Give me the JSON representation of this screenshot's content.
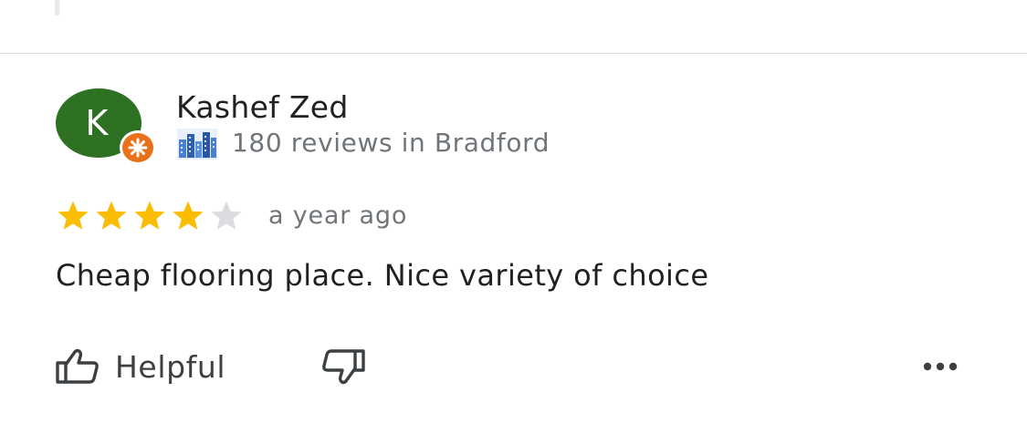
{
  "review": {
    "avatar_initial": "K",
    "avatar_color": "#2e7123",
    "badge_color": "#e8711a",
    "reviewer_name": "Kashef Zed",
    "reviewer_meta": "180 reviews in Bradford",
    "rating": 4,
    "rating_max": 5,
    "star_color_filled": "#fbbc04",
    "star_color_empty": "#dadce0",
    "age": "a year ago",
    "text": "Cheap flooring place. Nice variety of choice"
  },
  "actions": {
    "helpful_label": "Helpful",
    "helpful_icon": "thumb-up-icon",
    "not_helpful_icon": "thumb-down-icon",
    "more_icon": "more-horizontal-icon"
  }
}
